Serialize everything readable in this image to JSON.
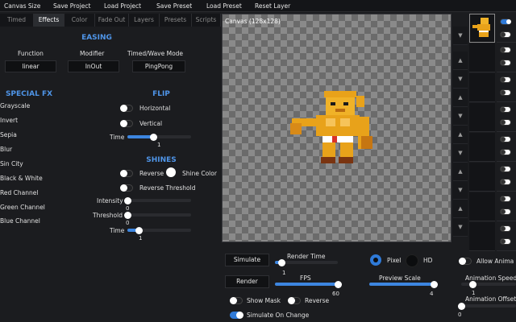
{
  "menu": [
    "Canvas Size",
    "Save Project",
    "Load Project",
    "Save Preset",
    "Load Preset",
    "Reset Layer"
  ],
  "tabs": [
    "Timed",
    "Effects",
    "Color",
    "Fade Out",
    "Layers",
    "Presets",
    "Scripts"
  ],
  "easing": {
    "title": "EASING",
    "function_label": "Function",
    "function_value": "linear",
    "modifier_label": "Modifier",
    "modifier_value": "InOut",
    "mode_label": "Timed/Wave Mode",
    "mode_value": "PingPong"
  },
  "special_fx": {
    "title": "SPECIAL FX",
    "items": [
      "Grayscale",
      "Invert",
      "Sepia",
      "Blur",
      "Sin City",
      "Black & White",
      "Red Channel",
      "Green Channel",
      "Blue Channel"
    ]
  },
  "flip": {
    "title": "FLIP",
    "horizontal": "Horizontal",
    "vertical": "Vertical",
    "time_label": "Time",
    "time_value": "1",
    "time_level": 0.4
  },
  "shines": {
    "title": "SHINES",
    "reverse": "Reverse",
    "shine_color": "Shine Color",
    "reverse_threshold": "Reverse Threshold",
    "intensity_label": "Intensity",
    "intensity_value": "0",
    "intensity_level": 0.0,
    "threshold_label": "Threshold",
    "threshold_value": "0",
    "threshold_level": 0.0,
    "time_label": "Time",
    "time_value": "1",
    "time_level": 0.18
  },
  "canvas": {
    "title": "Canvas (128x128)"
  },
  "bottom": {
    "simulate": "Simulate",
    "render": "Render",
    "render_time_label": "Render Time",
    "render_time_value": "1",
    "render_time_level": 0.1,
    "fps_label": "FPS",
    "fps_value": "60",
    "fps_level": 1.0,
    "pixel": "Pixel",
    "hd": "HD",
    "preview_scale_label": "Preview Scale",
    "preview_scale_value": "4",
    "preview_scale_level": 1.0,
    "show_mask": "Show Mask",
    "reverse": "Reverse",
    "simulate_on_change": "Simulate On Change",
    "allow_anim": "Allow Anima",
    "anim_speed_label": "Animation Speed",
    "anim_speed_value": "1",
    "anim_offset_label": "Animation Offset",
    "anim_offset_value": "0"
  },
  "colors": {
    "accent": "#3d86e0",
    "header": "#4f95e8"
  }
}
